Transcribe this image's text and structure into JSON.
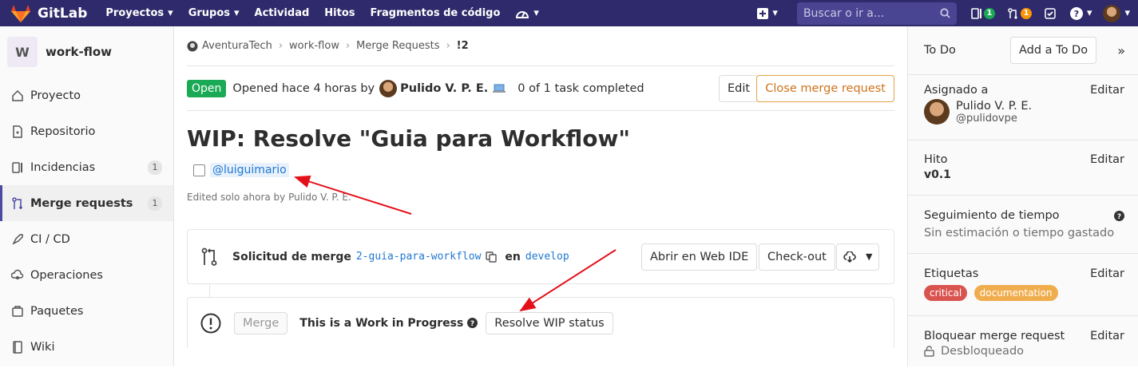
{
  "colors": {
    "nav_bg": "#2f2a6b",
    "open": "#1aaa55",
    "link": "#1f78d1",
    "warning": "#d0731a",
    "arrow": "#e3101a",
    "label_critical": "#d9534f",
    "label_documentation": "#f0ad4e",
    "merge_badge": "#fc9403",
    "issues_badge": "#1aaa55"
  },
  "topnav": {
    "brand": "GitLab",
    "items": [
      "Proyectos",
      "Grupos",
      "Actividad",
      "Hitos",
      "Fragmentos de código"
    ],
    "search_placeholder": "Buscar o ir a...",
    "issues_count": "1",
    "mr_count": "1"
  },
  "sidebar": {
    "project_initial": "W",
    "project_name": "work-flow",
    "items": [
      {
        "label": "Proyecto",
        "icon": "home-icon"
      },
      {
        "label": "Repositorio",
        "icon": "doc-icon"
      },
      {
        "label": "Incidencias",
        "icon": "issues-icon",
        "count": "1"
      },
      {
        "label": "Merge requests",
        "icon": "merge-request-icon",
        "count": "1"
      },
      {
        "label": "CI / CD",
        "icon": "rocket-icon"
      },
      {
        "label": "Operaciones",
        "icon": "cloud-gear-icon"
      },
      {
        "label": "Paquetes",
        "icon": "package-icon"
      },
      {
        "label": "Wiki",
        "icon": "book-icon"
      }
    ]
  },
  "breadcrumb": [
    "AventuraTech",
    "work-flow",
    "Merge Requests",
    "!2"
  ],
  "mr": {
    "status": "Open",
    "opened": "Opened hace 4 horas by",
    "author": "Pulido V. P. E.",
    "tasks": "0 of 1 task completed",
    "edit_label": "Edit",
    "close_label": "Close merge request",
    "title": "WIP: Resolve \"Guia para Workflow\"",
    "task_mention": "@luiguimario",
    "edited": "Edited solo ahora by Pulido V. P. E."
  },
  "merge_widget": {
    "prefix": "Solicitud de merge",
    "source_branch": "2-guia-para-workflow",
    "in": "en",
    "target_branch": "develop",
    "web_ide": "Abrir en Web IDE",
    "checkout": "Check-out",
    "merge_label": "Merge",
    "wip_text": "This is a Work in Progress",
    "resolve_wip": "Resolve WIP status"
  },
  "right_sidebar": {
    "todo": "To Do",
    "add_todo": "Add a To Do",
    "assignee_title": "Asignado a",
    "assignee_name": "Pulido V. P. E.",
    "assignee_handle": "@pulidovpe",
    "edit": "Editar",
    "milestone_title": "Hito",
    "milestone": "v0.1",
    "time_title": "Seguimiento de tiempo",
    "time_value": "Sin estimación o tiempo gastado",
    "labels_title": "Etiquetas",
    "labels": [
      "critical",
      "documentation"
    ],
    "lock_title": "Bloquear merge request",
    "lock_value": "Desbloqueado"
  }
}
